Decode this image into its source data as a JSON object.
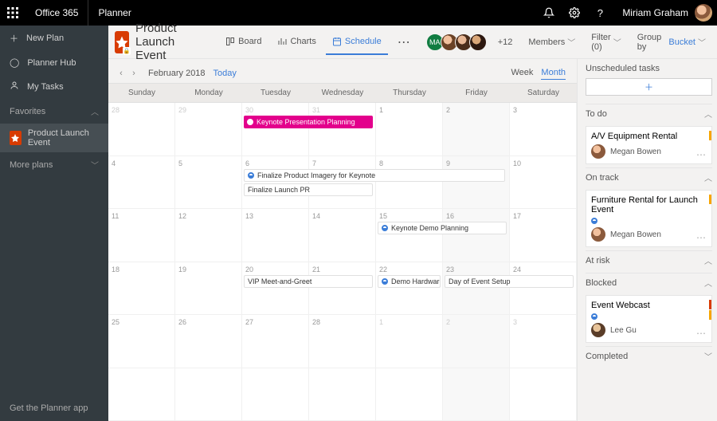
{
  "topbar": {
    "brand": "Office 365",
    "app": "Planner",
    "user_name": "Miriam Graham"
  },
  "sidebar": {
    "new_plan": "New Plan",
    "hub": "Planner Hub",
    "mytasks": "My Tasks",
    "favorites_label": "Favorites",
    "fav_item": "Product Launch Event",
    "more_plans": "More plans",
    "footer": "Get the Planner app"
  },
  "header": {
    "plan_title": "Product Launch Event",
    "tabs": {
      "board": "Board",
      "charts": "Charts",
      "schedule": "Schedule"
    },
    "members_extra": "+12",
    "members_label": "Members",
    "filter_label": "Filter (0)",
    "group_by_label": "Group by",
    "group_by_value": "Bucket"
  },
  "calendar": {
    "month_label": "February 2018",
    "today": "Today",
    "view_week": "Week",
    "view_month": "Month",
    "days": [
      "Sunday",
      "Monday",
      "Tuesday",
      "Wednesday",
      "Thursday",
      "Friday",
      "Saturday"
    ],
    "events": {
      "keynote_planning": "Keynote Presentation Planning",
      "finalize_imagery": "Finalize Product Imagery for Keynote",
      "finalize_pr": "Finalize Launch PR",
      "demo_planning": "Keynote Demo Planning",
      "vip": "VIP Meet-and-Greet",
      "demo_hw": "Demo Hardware",
      "day_setup": "Day of Event Setup"
    }
  },
  "right": {
    "unscheduled": "Unscheduled tasks",
    "buckets": {
      "todo": "To do",
      "ontrack": "On track",
      "atrisk": "At risk",
      "blocked": "Blocked",
      "completed": "Completed"
    },
    "tasks": {
      "av_rental": "A/V Equipment Rental",
      "megan": "Megan Bowen",
      "furniture": "Furniture Rental for Launch Event",
      "webcast": "Event Webcast",
      "lee": "Lee Gu"
    }
  }
}
